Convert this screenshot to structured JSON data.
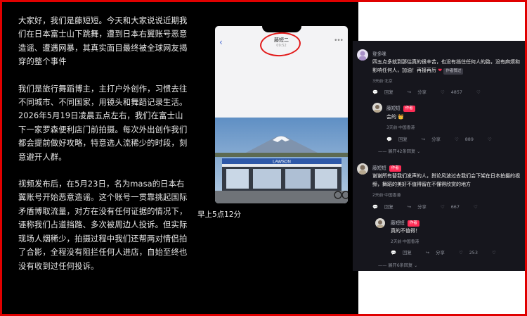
{
  "article": {
    "paragraphs": [
      "大家好，我们是藤短短。今天和大家说说近期我们在日本富士山下跳舞，遭到日本右翼账号恶意造谣、遭遇网暴，其真实面目最终被全球网友揭穿的整个事件",
      "我们是旅行舞蹈博主，主打户外创作，习惯去往不同城市、不同国家，用镜头和舞蹈记录生活。2026年5月19日凌晨五点左右，我们在富士山下一家罗森便利店门前拍摄。每次外出创作我们都会提前做好攻略，特意选人流稀少的时段，刻意避开人群。",
      "视频发布后，在5月23日，名为masa的日本右翼账号开始恶意造谣。这个账号一贯靠挑起国际矛盾博取流量，对方在没有任何证据的情况下，诬称我们占道挡路、多次被周边人投诉。但实际现场人烟稀少，拍摄过程中我们还帮两对情侣拍了合影，全程没有阻拦任何人进店，自始至终也没有收到过任何投诉。"
    ]
  },
  "phone": {
    "contact_name": "藤短二",
    "contact_sub": "09:52",
    "store_sign": "LAWSON"
  },
  "time_caption": "早上5点12分",
  "comments": [
    {
      "name": "登多咪",
      "text": "四五点多就到那估真的很辛苦，也没有挡住任何人的路，没有麻烦和影响任何人，加油！再接再厉",
      "liked_tag": "作者赞过",
      "meta": "3天前·北京",
      "reply": "回复",
      "share": "分享",
      "likes": "4857"
    },
    {
      "name": "藤短短",
      "author_tag": "作者",
      "text": "会的 👑",
      "meta": "3天前·中国香港",
      "reply": "回复",
      "share": "分享",
      "likes": "889"
    },
    {
      "expand": "展开42条回复"
    },
    {
      "name": "藤短短",
      "author_tag": "作者",
      "text": "谢谢所有替我们发声的人，舆论风波过去我们会下架在日本拍摄的视频，舞蹈的美好不值得留在不懂得欣赏的地方",
      "meta": "2天前·中国香港",
      "reply": "回复",
      "share": "分享",
      "likes": "667"
    },
    {
      "name": "藤短短",
      "author_tag": "作者",
      "text": "真的不值得！",
      "meta": "2天前·中国香港",
      "reply": "回复",
      "share": "分享",
      "likes": "253"
    },
    {
      "expand": "展开6条回复"
    }
  ],
  "colors": {
    "frame": "#e00000",
    "accent": "#fe2c55",
    "panel": "#000000"
  },
  "icons": [
    "back-chevron-icon",
    "more-dots-icon",
    "share-icon",
    "heart-icon",
    "broken-heart-icon",
    "chevron-down-icon"
  ]
}
